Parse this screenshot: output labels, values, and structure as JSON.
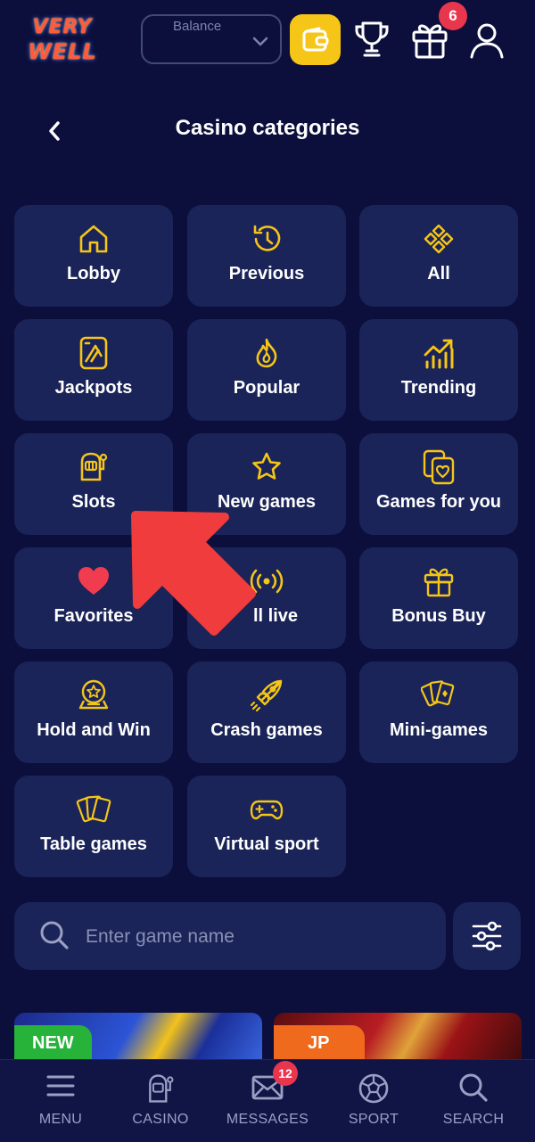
{
  "header": {
    "logo": {
      "line1": "VERY",
      "line2": "WELL"
    },
    "balance_label": "Balance",
    "gift_badge": "6"
  },
  "page": {
    "title": "Casino categories"
  },
  "categories": [
    {
      "label": "Lobby",
      "icon": "home-icon"
    },
    {
      "label": "Previous",
      "icon": "history-icon"
    },
    {
      "label": "All",
      "icon": "diamonds-icon"
    },
    {
      "label": "Jackpots",
      "icon": "jackpot-card-icon"
    },
    {
      "label": "Popular",
      "icon": "flame-icon"
    },
    {
      "label": "Trending",
      "icon": "trending-chart-icon"
    },
    {
      "label": "Slots",
      "icon": "slot-machine-icon"
    },
    {
      "label": "New games",
      "icon": "star-icon"
    },
    {
      "label": "Games for you",
      "icon": "heart-cards-icon"
    },
    {
      "label": "Favorites",
      "icon": "heart-icon"
    },
    {
      "label": "ll live",
      "icon": "broadcast-icon"
    },
    {
      "label": "Bonus Buy",
      "icon": "gift-box-icon"
    },
    {
      "label": "Hold and Win",
      "icon": "medal-icon"
    },
    {
      "label": "Crash games",
      "icon": "rocket-icon"
    },
    {
      "label": "Mini-games",
      "icon": "card-fan-icon"
    },
    {
      "label": "Table games",
      "icon": "playing-cards-icon"
    },
    {
      "label": "Virtual sport",
      "icon": "gamepad-icon"
    }
  ],
  "search": {
    "placeholder": "Enter game name"
  },
  "banners": [
    {
      "tag": "NEW"
    },
    {
      "tag": "JP"
    }
  ],
  "bottom_nav": [
    {
      "label": "MENU",
      "icon": "menu-icon"
    },
    {
      "label": "CASINO",
      "icon": "slot-machine-icon"
    },
    {
      "label": "MESSAGES",
      "icon": "envelope-icon"
    },
    {
      "label": "SPORT",
      "icon": "soccer-ball-icon"
    },
    {
      "label": "SEARCH",
      "icon": "search-icon"
    }
  ],
  "messages_badge": "12",
  "colors": {
    "background": "#0c0f3c",
    "tile": "#1a2458",
    "accent": "#f5c518",
    "badge": "#e8364c",
    "arrow": "#f03c3c"
  }
}
